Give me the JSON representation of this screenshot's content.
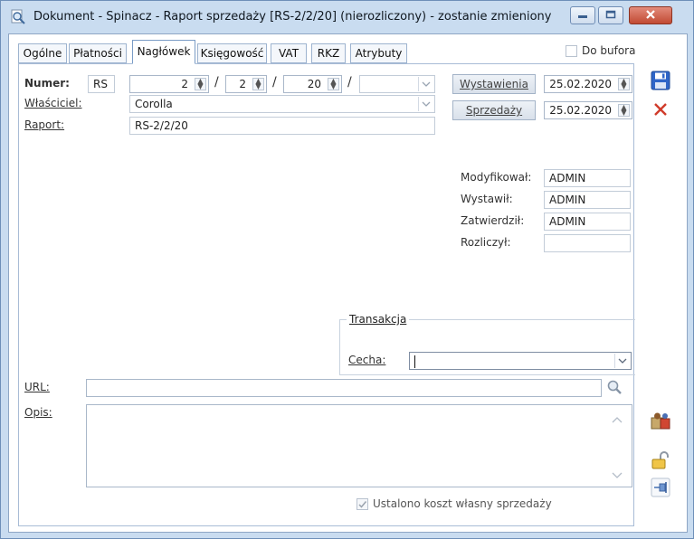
{
  "window": {
    "title": "Dokument - Spinacz - Raport sprzedaży [RS-2/2/20] (nierozliczony) - zostanie zmieniony"
  },
  "tabs": [
    {
      "label": "Ogólne"
    },
    {
      "label": "Płatności"
    },
    {
      "label": "Nagłówek"
    },
    {
      "label": "Księgowość"
    },
    {
      "label": "VAT"
    },
    {
      "label": "RKZ"
    },
    {
      "label": "Atrybuty"
    }
  ],
  "header": {
    "do_bufora_label": "Do bufora",
    "do_bufora_checked": false
  },
  "form": {
    "numer_label": "Numer:",
    "numer_prefix": "RS",
    "numer_part1": "2",
    "numer_part2": "2",
    "numer_part3": "20",
    "numer_sep": "/",
    "numer_series": "",
    "wlasciciel_label": "Właściciel:",
    "wlasciciel_value": "Corolla",
    "raport_label": "Raport:",
    "raport_value": "RS-2/2/20",
    "wystawienia_button": "Wystawienia",
    "wystawienia_date": "25.02.2020",
    "sprzedazy_button": "Sprzedaży",
    "sprzedazy_date": "25.02.2020"
  },
  "audit": {
    "modyfikowal_label": "Modyfikował:",
    "modyfikowal_value": "ADMIN",
    "wystawil_label": "Wystawił:",
    "wystawil_value": "ADMIN",
    "zatwierdzil_label": "Zatwierdził:",
    "zatwierdzil_value": "ADMIN",
    "rozliczyl_label": "Rozliczył:",
    "rozliczyl_value": ""
  },
  "transakcja": {
    "group_title": "Transakcja",
    "cecha_label": "Cecha:",
    "cecha_value": ""
  },
  "url": {
    "label": "URL:",
    "value": ""
  },
  "opis": {
    "label": "Opis:",
    "value": ""
  },
  "footer": {
    "koszt_label": "Ustalono koszt własny sprzedaży",
    "koszt_checked": true
  },
  "colors": {
    "accent": "#c9dcf0",
    "close_red": "#d03b2a",
    "save_blue": "#2f66c8"
  }
}
